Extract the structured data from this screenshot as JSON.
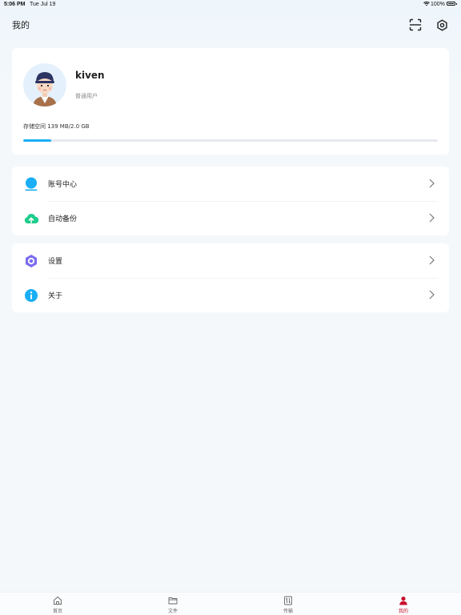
{
  "status_bar": {
    "time": "5:06 PM",
    "date": "Tue Jul 19",
    "battery_percent": "100%"
  },
  "header": {
    "title": "我的",
    "scan_icon": "scan-icon",
    "settings_icon": "gear-icon"
  },
  "profile": {
    "username": "kiven",
    "role": "普通用户",
    "storage_label": "存储空间 139 MB/2.0 GB",
    "storage_used_fraction": 0.068
  },
  "menu_group_1": [
    {
      "label": "账号中心",
      "icon": "account-icon",
      "color": "#1aaef5"
    },
    {
      "label": "自动备份",
      "icon": "cloud-upload-icon",
      "color": "#1dcc8c"
    }
  ],
  "menu_group_2": [
    {
      "label": "设置",
      "icon": "settings-hex-icon",
      "color": "#7b6cf0"
    },
    {
      "label": "关于",
      "icon": "info-icon",
      "color": "#1aaef5"
    }
  ],
  "tabs": [
    {
      "label": "首页",
      "icon": "home-icon",
      "active": false
    },
    {
      "label": "文件",
      "icon": "folder-icon",
      "active": false
    },
    {
      "label": "传输",
      "icon": "transfer-icon",
      "active": false
    },
    {
      "label": "我的",
      "icon": "user-icon",
      "active": true
    }
  ],
  "colors": {
    "accent": "#1aaef5",
    "active_tab": "#c8102e"
  }
}
